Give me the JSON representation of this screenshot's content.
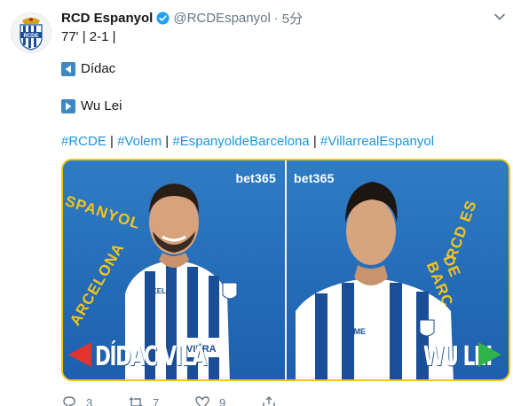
{
  "tweet": {
    "display_name": "RCD Espanyol",
    "handle": "@RCDEspanyol",
    "separator": "·",
    "time": "5分",
    "lines": {
      "score": "77' | 2-1 |",
      "player_out": "Dídac",
      "player_in": "Wu Lei"
    },
    "hashtags": [
      "#RCDE",
      "#Volem",
      "#EspanyoldeBarcelona",
      "#VillarrealEspanyol"
    ],
    "hashtag_separator": " | "
  },
  "media": {
    "left": {
      "sponsor": "bet365",
      "arc_text_top": "SPANYOL",
      "arc_text_bottom": "ARCELONA",
      "name": "DÍDAC VILÀ",
      "shirt_sponsor": "VIERA"
    },
    "right": {
      "sponsor": "bet365",
      "arc_text_top": "RCD ES",
      "arc_text_bottom": "DE BARC",
      "name": "WU LEI",
      "shirt_sponsor": "ELME"
    }
  },
  "actions": {
    "reply_count": "3",
    "retweet_count": "7",
    "like_count": "9"
  },
  "colors": {
    "link": "#1b95e0",
    "muted": "#657786",
    "media_blue": "#1d5fae",
    "accent_yellow": "#f5c518",
    "arrow_red": "#e4332d",
    "arrow_green": "#2fb34a"
  },
  "icons": [
    "espanyol-crest-icon",
    "verified-badge-icon",
    "caret-down-icon",
    "play-left-icon",
    "play-right-icon",
    "reply-icon",
    "retweet-icon",
    "like-icon",
    "share-icon"
  ]
}
